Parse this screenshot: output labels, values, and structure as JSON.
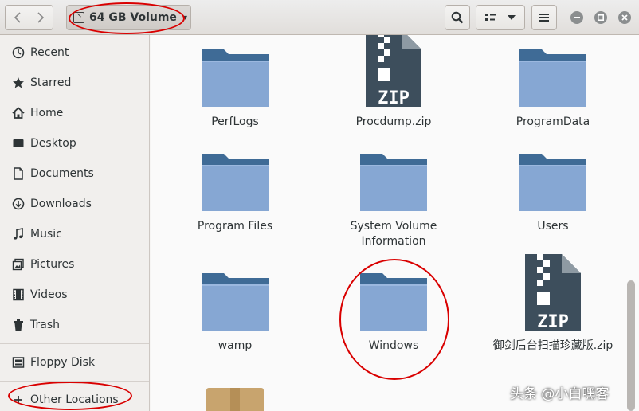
{
  "header": {
    "location": "64 GB Volume",
    "icons": {
      "back": "chevron-left-icon",
      "forward": "chevron-right-icon",
      "search": "search-icon",
      "view": "list-view-icon",
      "menu": "hamburger-menu-icon",
      "minimize": "minimize-icon",
      "maximize": "maximize-icon",
      "close": "close-icon"
    }
  },
  "sidebar": {
    "items": [
      {
        "label": "Recent",
        "icon": "clock-icon"
      },
      {
        "label": "Starred",
        "icon": "star-icon"
      },
      {
        "label": "Home",
        "icon": "home-icon"
      },
      {
        "label": "Desktop",
        "icon": "desktop-icon"
      },
      {
        "label": "Documents",
        "icon": "document-icon"
      },
      {
        "label": "Downloads",
        "icon": "download-icon"
      },
      {
        "label": "Music",
        "icon": "music-icon"
      },
      {
        "label": "Pictures",
        "icon": "pictures-icon"
      },
      {
        "label": "Videos",
        "icon": "video-icon"
      },
      {
        "label": "Trash",
        "icon": "trash-icon"
      }
    ],
    "devices": [
      {
        "label": "Floppy Disk",
        "icon": "floppy-icon"
      }
    ],
    "other": {
      "label": "Other Locations",
      "icon": "plus-icon"
    }
  },
  "files": [
    {
      "name": "PerfLogs",
      "type": "folder"
    },
    {
      "name": "Procdump.zip",
      "type": "zip",
      "badge": "ZIP"
    },
    {
      "name": "ProgramData",
      "type": "folder"
    },
    {
      "name": "Program Files",
      "type": "folder"
    },
    {
      "name": "System Volume Information",
      "type": "folder"
    },
    {
      "name": "Users",
      "type": "folder"
    },
    {
      "name": "wamp",
      "type": "folder"
    },
    {
      "name": "Windows",
      "type": "folder"
    },
    {
      "name": "御剑后台扫描珍藏版.zip",
      "type": "zip",
      "badge": "ZIP"
    }
  ],
  "watermark": "头条 @小白嘿客",
  "colors": {
    "folder_top": "#3f6b96",
    "folder_body": "#86a7d3",
    "zip_body": "#3d4e5c",
    "annotation": "#d90000"
  }
}
